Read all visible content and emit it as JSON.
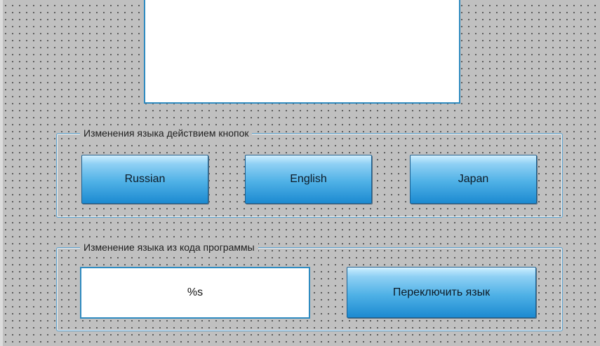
{
  "group_buttons": {
    "title": "Изменения языка действием кнопок",
    "russian_label": "Russian",
    "english_label": "English",
    "japan_label": "Japan"
  },
  "group_code": {
    "title": "Изменение языка из кода программы",
    "field_value": "%s",
    "switch_label": "Переключить язык"
  },
  "colors": {
    "background": "#c0c0c0",
    "accent_border": "#2f8bc0",
    "button_top": "#cdeeff",
    "button_bottom": "#1c8ad1"
  }
}
